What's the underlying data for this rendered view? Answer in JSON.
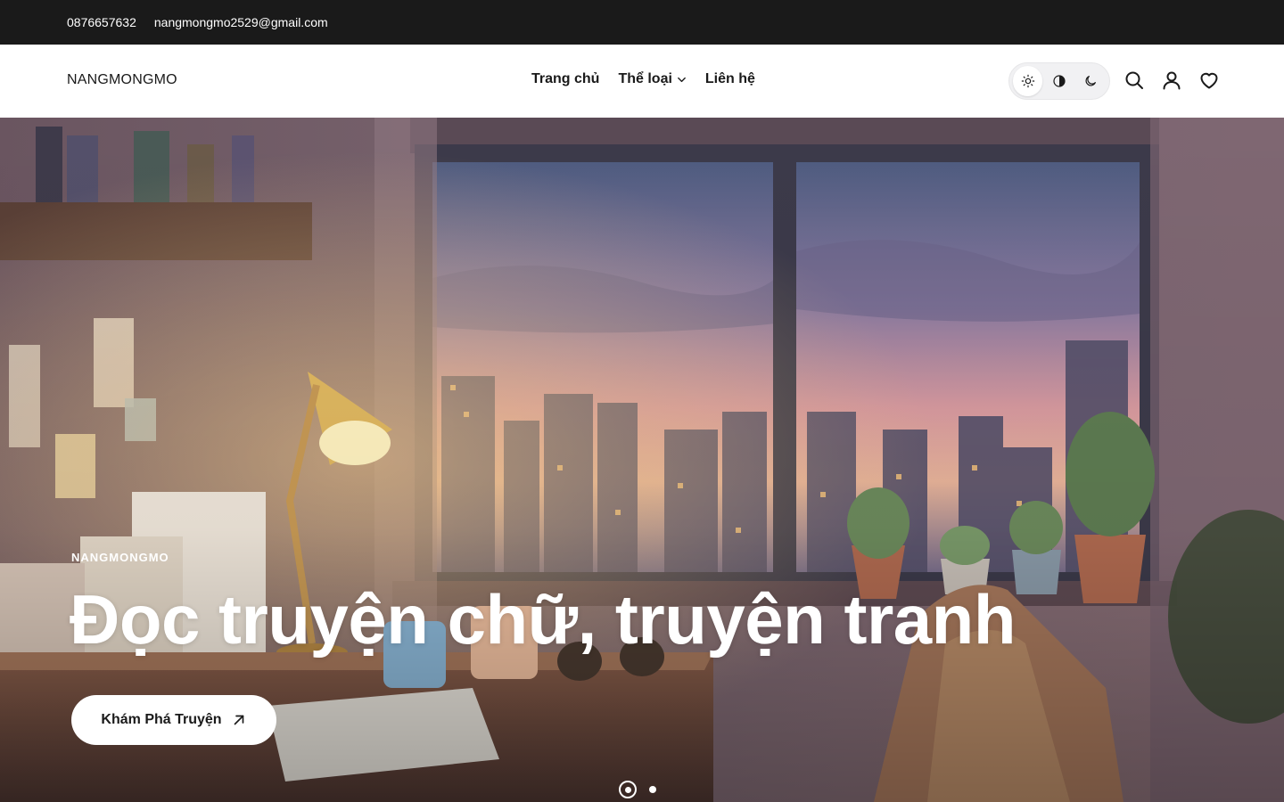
{
  "topbar": {
    "phone": "0876657632",
    "email": "nangmongmo2529@gmail.com"
  },
  "header": {
    "logo": "NANGMONGMO",
    "nav": [
      {
        "label": "Trang chủ"
      },
      {
        "label": "Thể loại",
        "has_dropdown": true
      },
      {
        "label": "Liên hệ"
      }
    ],
    "theme_modes": [
      "light",
      "auto",
      "dark"
    ],
    "theme_selected": "light",
    "icons": [
      "search-icon",
      "user-icon",
      "heart-icon"
    ]
  },
  "hero": {
    "kicker": "NANGMONGMO",
    "title": "Đọc truyện chữ, truyện tranh",
    "cta_label": "Khám Phá Truyện",
    "slides_total": 2,
    "slide_active": 1
  },
  "colors": {
    "topbar_bg": "#1a1a1a",
    "header_bg": "#ffffff",
    "text": "#1a1a1a",
    "hero_text": "#ffffff"
  }
}
